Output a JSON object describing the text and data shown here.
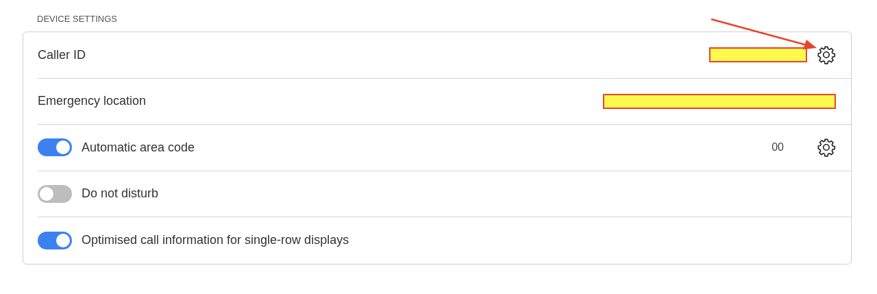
{
  "section_title": "DEVICE SETTINGS",
  "rows": [
    {
      "kind": "text",
      "label": "Caller ID",
      "redacted": true,
      "gear": true
    },
    {
      "kind": "text",
      "label": "Emergency location",
      "redacted": true,
      "gear": false
    },
    {
      "kind": "toggle",
      "label": "Automatic area code",
      "on": true,
      "value": "00",
      "gear": true
    },
    {
      "kind": "toggle",
      "label": "Do not disturb",
      "on": false,
      "gear": false
    },
    {
      "kind": "toggle",
      "label": "Optimised call information for single-row displays",
      "on": true,
      "gear": false
    }
  ],
  "annotations": [
    {
      "kind": "arrow"
    }
  ]
}
